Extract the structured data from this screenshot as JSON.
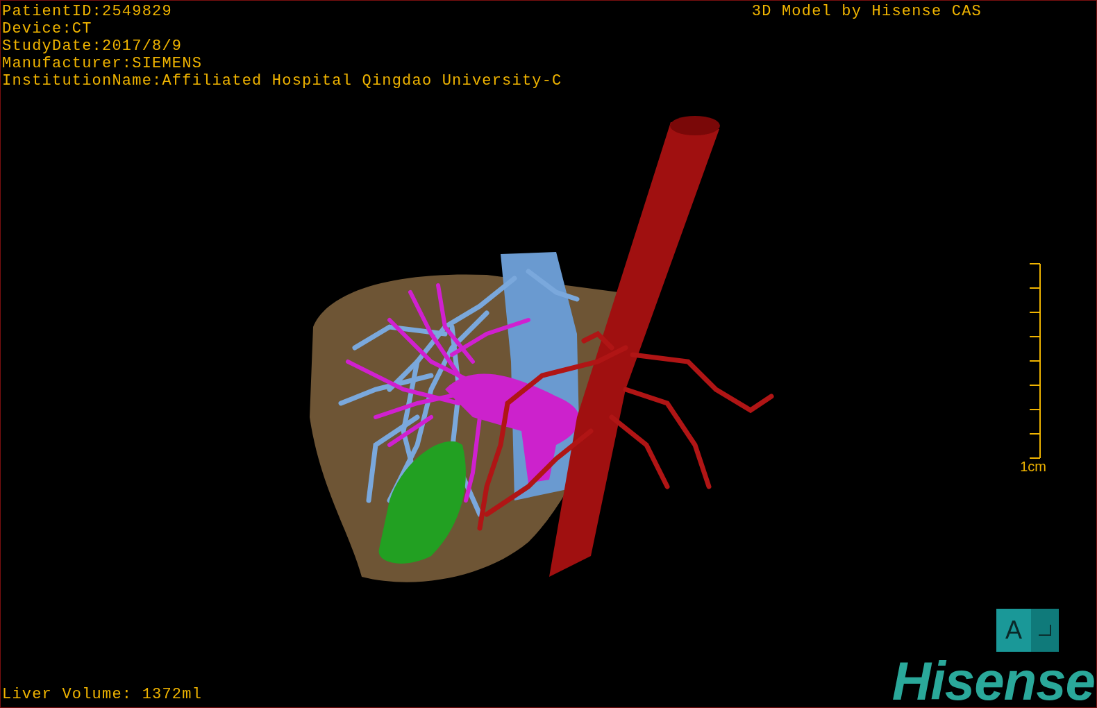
{
  "patient_info": [
    "PatientID:2549829",
    "Device:CT",
    "StudyDate:2017/8/9",
    "Manufacturer:SIEMENS",
    "InstitutionName:Affiliated Hospital Qingdao University-C"
  ],
  "model_title": "3D Model by Hisense CAS",
  "scale_bar": {
    "label": "1cm"
  },
  "orientation_marker": {
    "label": "A"
  },
  "liver_volume": "Liver Volume: 1372ml",
  "logo": "Hisense"
}
